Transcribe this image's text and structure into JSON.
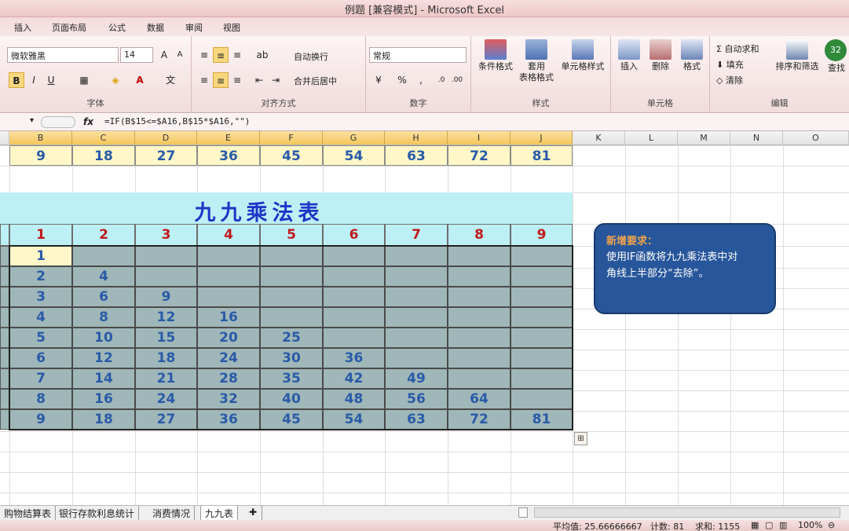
{
  "window": {
    "title": "例题 [兼容模式] - Microsoft Excel"
  },
  "ribbon_tabs": [
    "插入",
    "页面布局",
    "公式",
    "数据",
    "审阅",
    "视图"
  ],
  "font_group": {
    "label": "字体",
    "font_name": "微软雅黑",
    "font_size": "14"
  },
  "align_group": {
    "label": "对齐方式",
    "wrap_text": "自动换行",
    "merge_center": "合并后居中"
  },
  "number_group": {
    "label": "数字",
    "format": "常规"
  },
  "styles_group": {
    "label": "样式",
    "cond_format": "条件格式",
    "table_format_1": "套用",
    "table_format_2": "表格格式",
    "cell_styles": "单元格样式"
  },
  "cells_group": {
    "label": "单元格",
    "insert": "插入",
    "delete": "删除",
    "format": "格式"
  },
  "editing_group": {
    "label": "编辑",
    "autosum": "自动求和",
    "fill": "填充",
    "clear": "清除",
    "sort_filter": "排序和筛选",
    "find": "查找",
    "badge": "32"
  },
  "formula_bar": {
    "fx": "fx",
    "formula": "=IF(B$15<=$A16,B$15*$A16,\"\")"
  },
  "column_headers": [
    "B",
    "C",
    "D",
    "E",
    "F",
    "G",
    "H",
    "I",
    "J",
    "K",
    "L",
    "M",
    "N",
    "O"
  ],
  "top_row": [
    "9",
    "18",
    "27",
    "36",
    "45",
    "54",
    "63",
    "72",
    "81"
  ],
  "table_title": "九九乘法表",
  "header_row": [
    "1",
    "2",
    "3",
    "4",
    "5",
    "6",
    "7",
    "8",
    "9"
  ],
  "table_rows": [
    [
      "1"
    ],
    [
      "2",
      "4"
    ],
    [
      "3",
      "6",
      "9"
    ],
    [
      "4",
      "8",
      "12",
      "16"
    ],
    [
      "5",
      "10",
      "15",
      "20",
      "25"
    ],
    [
      "6",
      "12",
      "18",
      "24",
      "30",
      "36"
    ],
    [
      "7",
      "14",
      "21",
      "28",
      "35",
      "42",
      "49"
    ],
    [
      "8",
      "16",
      "24",
      "32",
      "40",
      "48",
      "56",
      "64"
    ],
    [
      "9",
      "18",
      "27",
      "36",
      "45",
      "54",
      "63",
      "72",
      "81"
    ]
  ],
  "callout": {
    "title": "新增要求：",
    "line1": "使用IF函数将九九乘法表中对",
    "line2": "角线上半部分“去除”。"
  },
  "sheet_tabs": [
    "购物结算表",
    "银行存款利息统计",
    "消费情况",
    "九九表"
  ],
  "status": {
    "average": "平均值: 25.66666667",
    "count": "计数: 81",
    "sum": "求和: 1155",
    "zoom": "100%"
  },
  "colors": {
    "title_blue": "#1f36c8",
    "header_red": "#c0191c",
    "value_blue": "#2a5aa8",
    "table_fill": "#9fb7b8",
    "title_band": "#bdf0f4",
    "top_fill": "#fff7c7"
  }
}
